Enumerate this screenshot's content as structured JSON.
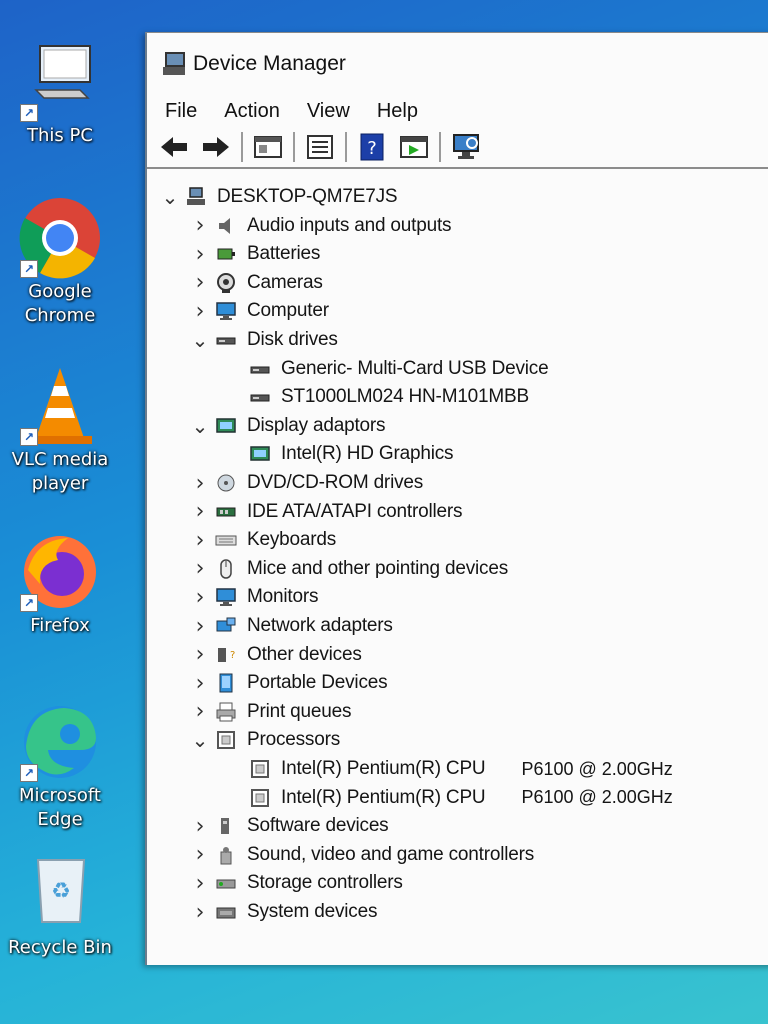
{
  "desktop": {
    "icons": [
      {
        "label_lines": [
          "This PC"
        ],
        "icon": "computer-icon"
      },
      {
        "label_lines": [
          "Google",
          "Chrome"
        ],
        "icon": "chrome-icon"
      },
      {
        "label_lines": [
          "VLC media",
          "player"
        ],
        "icon": "vlc-icon"
      },
      {
        "label_lines": [
          "Firefox"
        ],
        "icon": "firefox-icon"
      },
      {
        "label_lines": [
          "Microsoft",
          "Edge"
        ],
        "icon": "edge-icon"
      },
      {
        "label_lines": [
          "Recycle Bin"
        ],
        "icon": "recycle-bin-icon"
      }
    ]
  },
  "window": {
    "title": "Device Manager",
    "menu": [
      "File",
      "Action",
      "View",
      "Help"
    ],
    "toolbar": [
      "back-arrow-icon",
      "forward-arrow-icon",
      "properties-icon",
      "console-tree-icon",
      "help-icon",
      "run-icon",
      "scan-hardware-icon"
    ]
  },
  "tree": {
    "root": "DESKTOP-QM7E7JS",
    "nodes": [
      {
        "label": "Audio inputs and outputs",
        "expanded": false,
        "icon": "speaker-icon"
      },
      {
        "label": "Batteries",
        "expanded": false,
        "icon": "battery-icon"
      },
      {
        "label": "Cameras",
        "expanded": false,
        "icon": "camera-icon"
      },
      {
        "label": "Computer",
        "expanded": false,
        "icon": "monitor-icon"
      },
      {
        "label": "Disk drives",
        "expanded": true,
        "icon": "disk-drive-icon",
        "children": [
          "Generic- Multi-Card USB Device",
          "ST1000LM024 HN-M101MBB"
        ]
      },
      {
        "label": "Display adaptors",
        "expanded": true,
        "icon": "display-adapter-icon",
        "children": [
          "Intel(R) HD Graphics"
        ]
      },
      {
        "label": "DVD/CD-ROM drives",
        "expanded": false,
        "icon": "dvd-drive-icon"
      },
      {
        "label": "IDE ATA/ATAPI controllers",
        "expanded": false,
        "icon": "ide-controller-icon"
      },
      {
        "label": "Keyboards",
        "expanded": false,
        "icon": "keyboard-icon"
      },
      {
        "label": "Mice and other pointing devices",
        "expanded": false,
        "icon": "mouse-icon"
      },
      {
        "label": "Monitors",
        "expanded": false,
        "icon": "monitor-icon"
      },
      {
        "label": "Network adapters",
        "expanded": false,
        "icon": "network-adapter-icon"
      },
      {
        "label": "Other devices",
        "expanded": false,
        "icon": "other-devices-icon"
      },
      {
        "label": "Portable Devices",
        "expanded": false,
        "icon": "portable-device-icon"
      },
      {
        "label": "Print queues",
        "expanded": false,
        "icon": "printer-icon"
      },
      {
        "label": "Processors",
        "expanded": true,
        "icon": "processor-icon",
        "children": [
          {
            "name": "Intel(R) Pentium(R) CPU",
            "model": "P6100  @ 2.00GHz"
          },
          {
            "name": "Intel(R) Pentium(R) CPU",
            "model": "P6100  @ 2.00GHz"
          }
        ]
      },
      {
        "label": "Software devices",
        "expanded": false,
        "icon": "software-device-icon"
      },
      {
        "label": "Sound, video and game controllers",
        "expanded": false,
        "icon": "sound-controller-icon"
      },
      {
        "label": "Storage controllers",
        "expanded": false,
        "icon": "storage-controller-icon"
      },
      {
        "label": "System devices",
        "expanded": false,
        "icon": "system-devices-icon"
      }
    ]
  }
}
